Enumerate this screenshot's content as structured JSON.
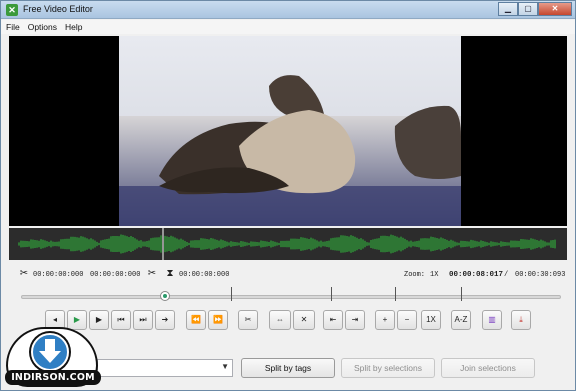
{
  "window": {
    "title": "Free Video Editor"
  },
  "menu": [
    "File",
    "Options",
    "Help"
  ],
  "timebar": {
    "sel_start": "00:00:00:000",
    "sel_end": "00:00:00:000",
    "cut_time": "00:00:00:000",
    "zoom_label": "Zoom:",
    "zoom_value": "1X",
    "current_time": "00:00:08:017",
    "separator": "/",
    "total_time": "00:00:30:093"
  },
  "toolbar": {
    "speed_label": "1X",
    "sort_label": "A-Z"
  },
  "bottom": {
    "split_tags": "Split by tags",
    "split_selections": "Split by selections",
    "join_selections": "Join selections"
  },
  "watermark": {
    "text": "INDIRSON.COM"
  },
  "colors": {
    "waveform": "#2fbf3b",
    "accent": "#2a9a6a"
  }
}
